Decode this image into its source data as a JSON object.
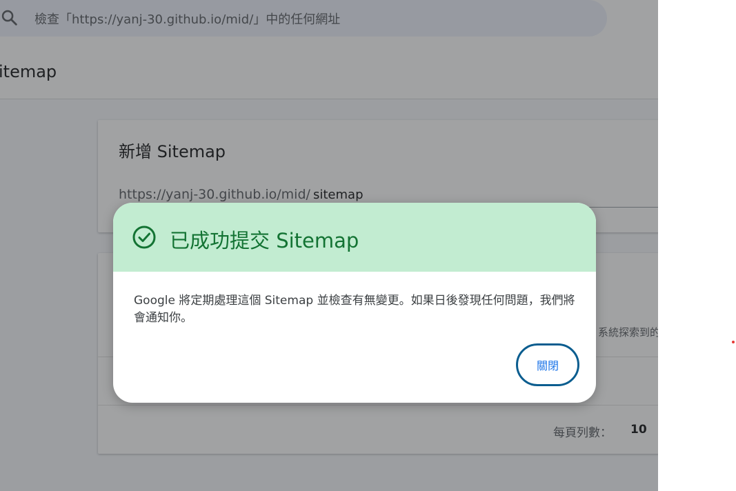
{
  "search": {
    "placeholder": "檢查「https://yanj-30.github.io/mid/」中的任何網址"
  },
  "page": {
    "title": "itemap"
  },
  "add_sitemap": {
    "title": "新增 Sitemap",
    "url_prefix": "https://yanj-30.github.io/mid/",
    "input_value": "sitemap"
  },
  "sitemap_list": {
    "hint": "系統探索到的",
    "rows_per_page_label": "每頁列數：",
    "rows_per_page_value": "10"
  },
  "dialog": {
    "title": "已成功提交 Sitemap",
    "body": "Google 將定期處理這個 Sitemap 並檢查有無變更。如果日後發現任何問題，我們將會通知你。",
    "close_label": "關閉"
  },
  "colors": {
    "dialog_header": "#c2ecd1",
    "success_green": "#137333",
    "close_border": "#0b5d8f"
  },
  "icons": {
    "search": "search-icon",
    "success": "check-circle-icon"
  }
}
